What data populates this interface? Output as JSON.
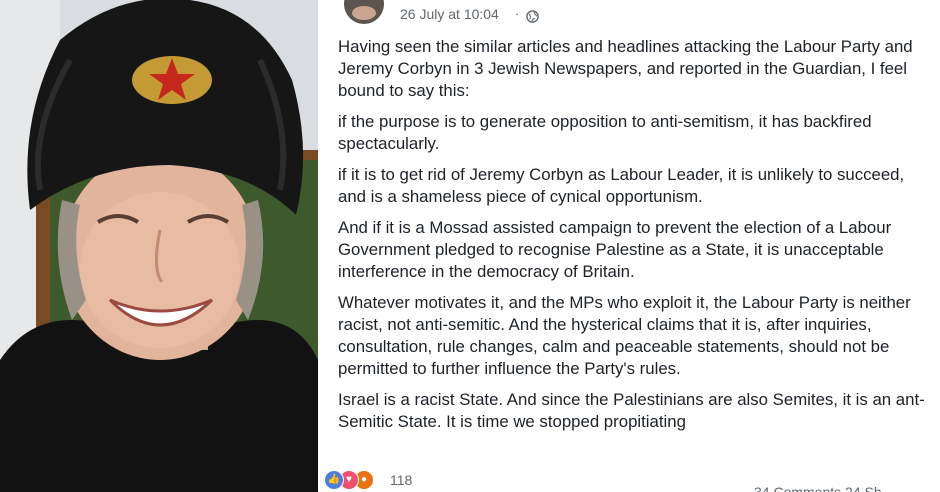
{
  "post": {
    "timestamp": "26 July at 10:04",
    "separator": "·",
    "privacy_icon": "globe-icon",
    "paragraphs": [
      "Having seen the similar articles and headlines attacking the Labour Party and Jeremy Corbyn in 3 Jewish Newspapers, and reported in the Guardian, I feel bound to say this:",
      "if the purpose is to generate opposition to anti-semitism, it has backfired spectacularly.",
      "if it is to get rid of Jeremy Corbyn as Labour Leader, it is unlikely to succeed, and is a shameless piece of cynical opportunism.",
      "And if it is a Mossad assisted campaign to prevent the election of a Labour Government pledged to recognise Palestine as a State, it is unacceptable interference in the democracy of Britain.",
      "Whatever motivates it, and the MPs who exploit it, the Labour Party is neither racist, not anti-semitic. And the hysterical claims that it is, after inquiries, consultation, rule changes, calm and peaceable statements, should not be permitted to further influence the Party's rules.",
      "Israel is a racist State. And since the Palestinians are also Semites, it is an ant-Semitic State. It is time we stopped propitiating"
    ]
  },
  "footer": {
    "reactions": [
      "like-icon",
      "love-icon",
      "angry-icon"
    ],
    "reaction_count": "118",
    "comments_shares": "34 Comments  24 Sh"
  },
  "colors": {
    "text": "#1d2129",
    "meta": "#616770",
    "like": "#4a7fe0",
    "love": "#f0506e",
    "angry": "#e9730f"
  }
}
